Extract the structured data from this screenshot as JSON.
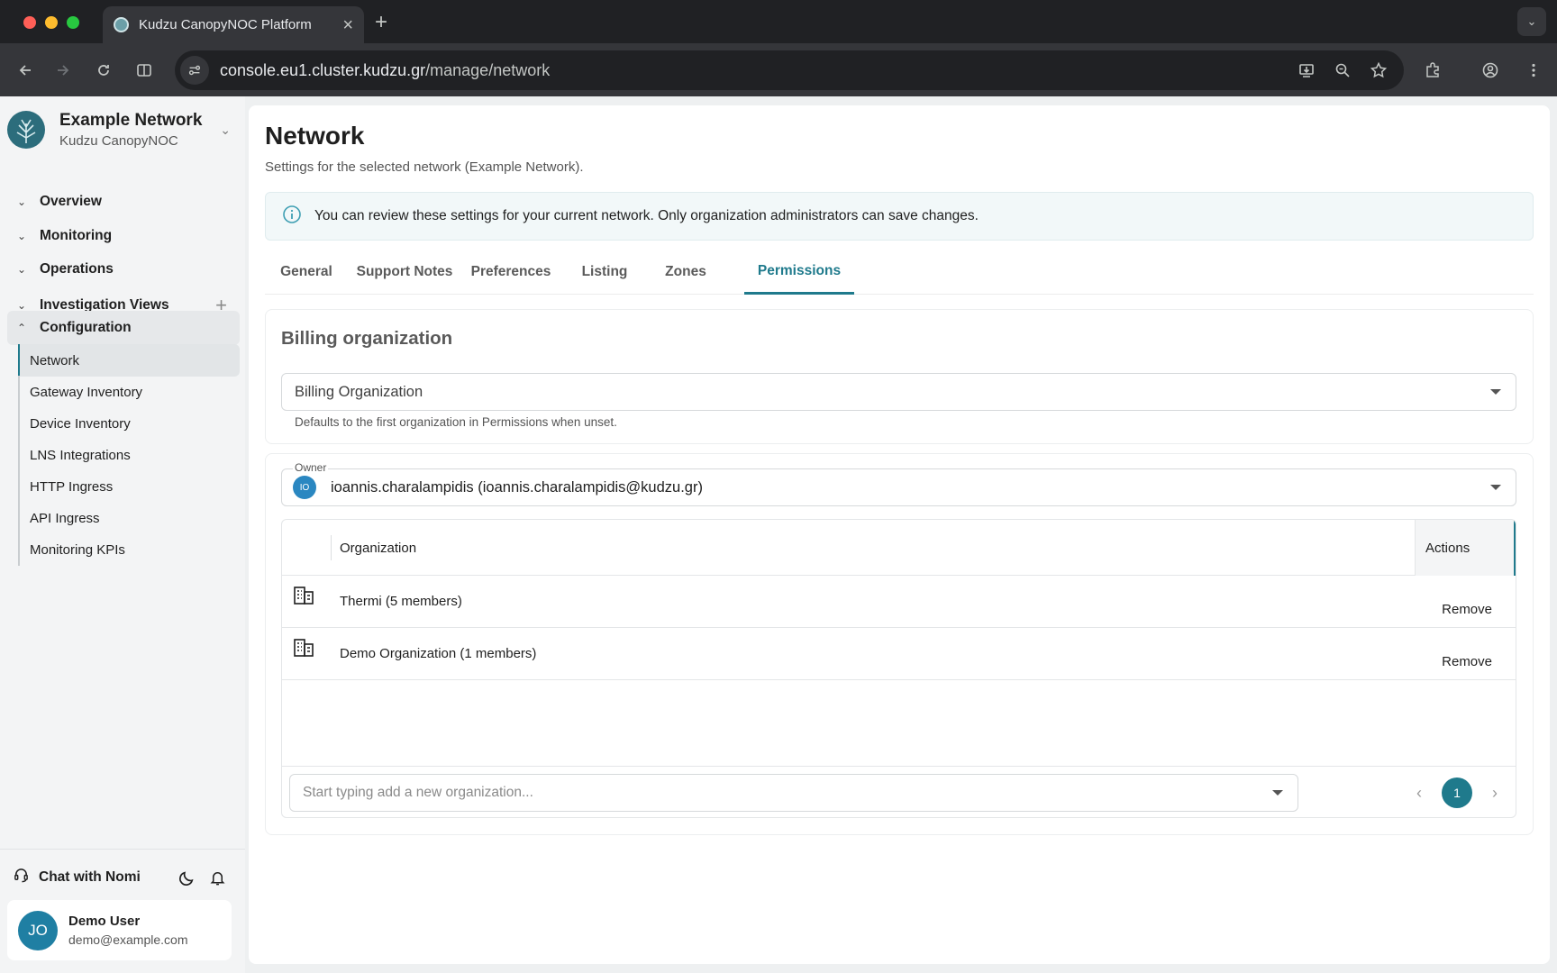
{
  "browser": {
    "tab_title": "Kudzu CanopyNOC Platform",
    "url_host": "console.eu1.cluster.kudzu.gr",
    "url_path": "/manage/network"
  },
  "sidebar": {
    "brand_name": "Example Network",
    "brand_sub": "Kudzu CanopyNOC",
    "sections": [
      {
        "label": "Overview",
        "expanded": false
      },
      {
        "label": "Monitoring",
        "expanded": false
      },
      {
        "label": "Operations",
        "expanded": false
      },
      {
        "label": "Investigation Views",
        "expanded": false
      },
      {
        "label": "Configuration",
        "expanded": true
      }
    ],
    "config_items": [
      {
        "label": "Network",
        "active": true
      },
      {
        "label": "Gateway Inventory"
      },
      {
        "label": "Device Inventory"
      },
      {
        "label": "LNS Integrations"
      },
      {
        "label": "HTTP Ingress"
      },
      {
        "label": "API Ingress"
      },
      {
        "label": "Monitoring KPIs"
      }
    ],
    "chat_label": "Chat with Nomi",
    "user": {
      "initials": "JO",
      "name": "Demo User",
      "email": "demo@example.com"
    }
  },
  "main": {
    "title": "Network",
    "subtitle": "Settings for the selected network (Example Network).",
    "info": "You can review these settings for your current network. Only organization administrators can save changes.",
    "tabs": [
      {
        "label": "General"
      },
      {
        "label": "Support Notes"
      },
      {
        "label": "Preferences"
      },
      {
        "label": "Listing"
      },
      {
        "label": "Zones"
      },
      {
        "label": "Permissions",
        "active": true
      }
    ],
    "billing": {
      "title": "Billing organization",
      "select_value": "Billing Organization",
      "helper": "Defaults to the first organization in Permissions when unset."
    },
    "permissions": {
      "owner_label": "Owner",
      "owner_initials": "IO",
      "owner_value": "ioannis.charalampidis (ioannis.charalampidis@kudzu.gr)",
      "columns": {
        "organization": "Organization",
        "actions": "Actions"
      },
      "rows": [
        {
          "organization": "Thermi (5 members)",
          "action": "Remove"
        },
        {
          "organization": "Demo Organization (1 members)",
          "action": "Remove"
        }
      ],
      "add_placeholder": "Start typing add a new organization...",
      "page": "1"
    }
  },
  "colors": {
    "accent": "#1f7a8c",
    "avatar": "#1f7fa3"
  }
}
